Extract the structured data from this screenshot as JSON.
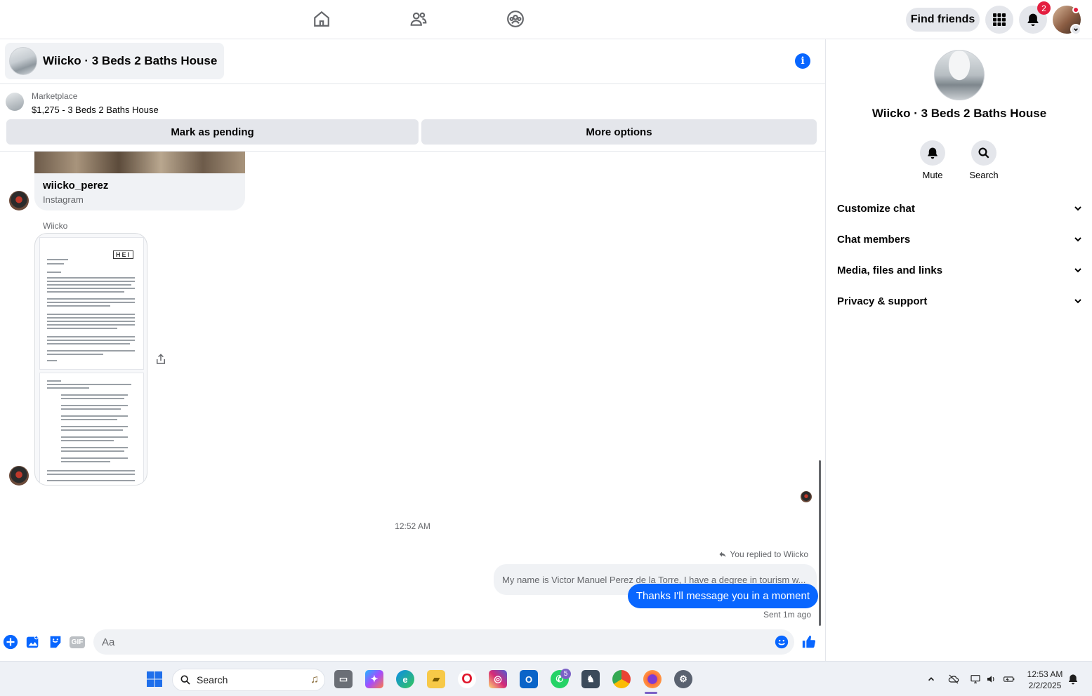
{
  "topbar": {
    "nav": [
      {
        "name": "home-icon"
      },
      {
        "name": "friends-icon"
      },
      {
        "name": "groups-icon"
      }
    ],
    "find_friends_label": "Find friends",
    "notifications_count": "2",
    "icons": {
      "menu": "grid-menu-icon",
      "notifications": "bell-icon",
      "profile": "profile-avatar"
    }
  },
  "chat": {
    "title": "Wiicko · 3 Beds 2 Baths House",
    "marketplace_label": "Marketplace",
    "listing": "$1,275 - 3 Beds 2 Baths House",
    "buttons": {
      "pending": "Mark as pending",
      "more": "More options"
    }
  },
  "messages": {
    "shared_account": "wiicko_perez",
    "shared_source": "Instagram",
    "sender": "Wiicko",
    "time": "12:52 AM",
    "replied_label": "You replied to Wiicko",
    "quoted_text": "My name is Victor Manuel Perez de la Torre, I have a degree in tourism w...",
    "outgoing_text": "Thanks I'll message you in a moment",
    "sent_status": "Sent 1m ago"
  },
  "composer": {
    "placeholder": "Aa",
    "gif_label": "GIF"
  },
  "right_panel": {
    "title": "Wiicko · 3 Beds 2 Baths House",
    "actions": [
      {
        "label": "Mute",
        "icon": "bell-icon"
      },
      {
        "label": "Search",
        "icon": "search-icon"
      }
    ],
    "sections": [
      "Customize chat",
      "Chat members",
      "Media, files and links",
      "Privacy & support"
    ]
  },
  "taskbar": {
    "search_label": "Search",
    "whatsapp_badge": "5",
    "time": "12:53 AM",
    "date": "2/2/2025"
  },
  "colors": {
    "accent": "#0866ff",
    "badge": "#e41e3f",
    "surface": "#f0f2f5",
    "button": "#e4e6eb"
  }
}
